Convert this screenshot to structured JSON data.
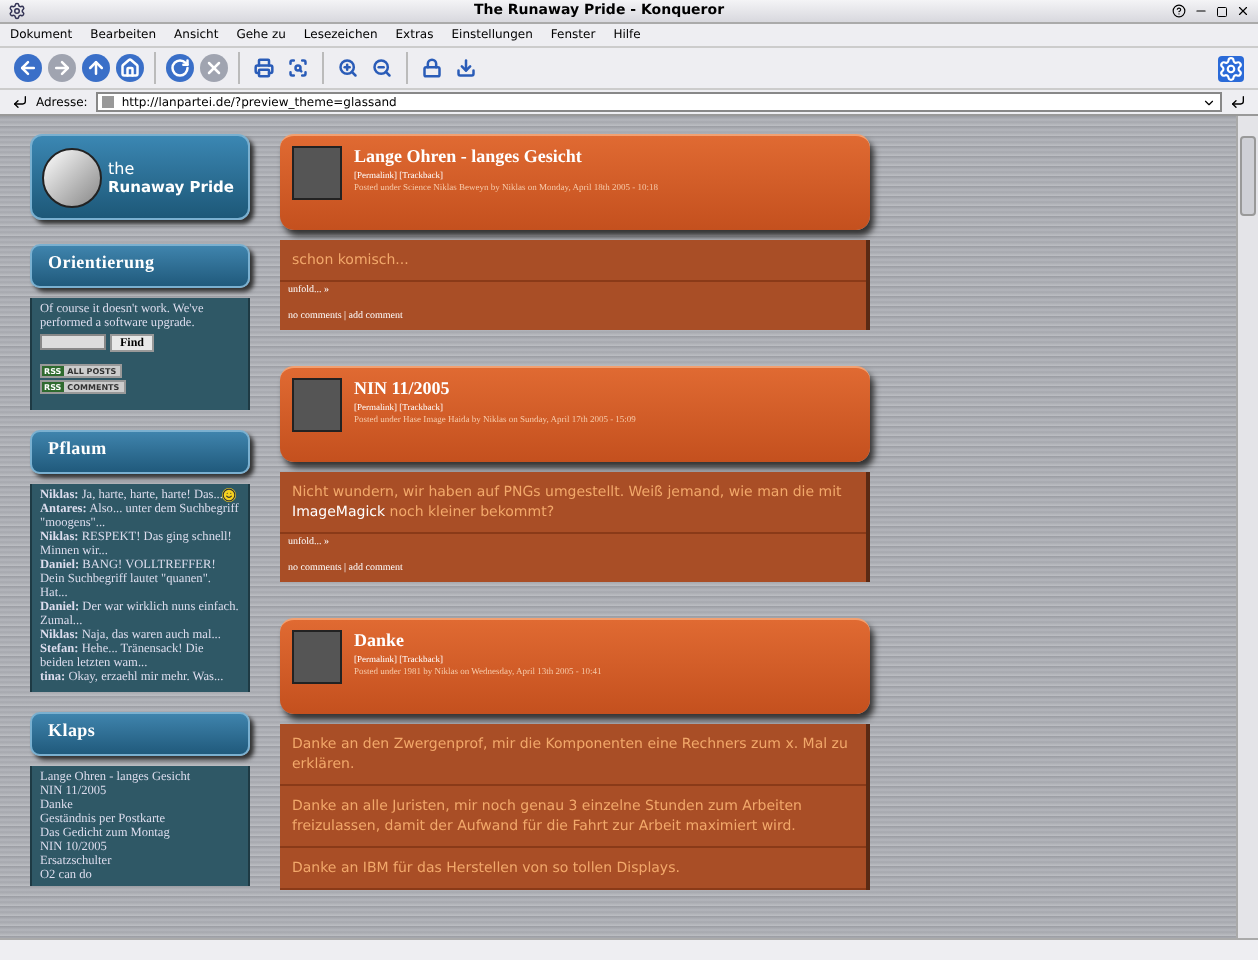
{
  "window": {
    "title": "The Runaway Pride - Konqueror"
  },
  "menu": [
    "Dokument",
    "Bearbeiten",
    "Ansicht",
    "Gehe zu",
    "Lesezeichen",
    "Extras",
    "Einstellungen",
    "Fenster",
    "Hilfe"
  ],
  "address": {
    "label": "Adresse:",
    "value": "http://lanpartei.de/?preview_theme=glassand"
  },
  "logo": {
    "line1": "the",
    "line2": "Runaway Pride"
  },
  "sidebar": [
    {
      "kind": "search",
      "title": "Orientierung",
      "text": "Of course it doesn't work. We've performed a software upgrade.",
      "button": "Find",
      "badges": [
        {
          "tag": "RSS",
          "label": "ALL POSTS"
        },
        {
          "tag": "RSS",
          "label": "COMMENTS"
        }
      ]
    },
    {
      "kind": "comments",
      "title": "Pflaum",
      "comments": [
        {
          "author": "Niklas:",
          "text": "Ja, harte, harte, harte! Das...",
          "emoticon": true
        },
        {
          "author": "Antares:",
          "text": "Also... unter dem Suchbegriff \"moogens\"...",
          "emoticon": false
        },
        {
          "author": "Niklas:",
          "text": "RESPEKT! Das ging schnell! Minnen wir...",
          "emoticon": false
        },
        {
          "author": "Daniel:",
          "text": "BANG! VOLLTREFFER! Dein Suchbegriff lautet \"quanen\". Hat...",
          "emoticon": false
        },
        {
          "author": "Daniel:",
          "text": "Der war wirklich nuns einfach. Zumal...",
          "emoticon": false
        },
        {
          "author": "Niklas:",
          "text": "Naja, das waren auch mal...",
          "emoticon": false
        },
        {
          "author": "Stefan:",
          "text": "Hehe... Tränensack! Die beiden letzten wam...",
          "emoticon": false
        },
        {
          "author": "tina:",
          "text": "Okay, erzaehl mir mehr. Was...",
          "emoticon": false
        }
      ]
    },
    {
      "kind": "links",
      "title": "Klaps",
      "links": [
        "Lange Ohren - langes Gesicht",
        "NIN 11/2005",
        "Danke",
        "Geständnis per Postkarte",
        "Das Gedicht zum Montag",
        "NIN 10/2005",
        "Ersatzschulter",
        "O2 can do"
      ]
    }
  ],
  "posts": [
    {
      "title": "Lange Ohren - langes Gesicht",
      "links": "[Permalink] [Trackback]",
      "meta": "Posted under Science Niklas Beweyn by Niklas on Monday, April 18th 2005 - 10:18",
      "paragraphs": [
        "schon komisch..."
      ],
      "unfold": "unfold... »",
      "footer": "no comments | add comment"
    },
    {
      "title": "NIN 11/2005",
      "links": "[Permalink] [Trackback]",
      "meta": "Posted under Hase Image Haida by Niklas on Sunday, April 17th 2005 - 15:09",
      "paragraphs": [
        "Nicht wundern, wir haben auf PNGs umgestellt. Weiß jemand, wie man die mit **ImageMagick** noch kleiner bekommt?"
      ],
      "unfold": "unfold... »",
      "footer": "no comments | add comment"
    },
    {
      "title": "Danke",
      "links": "[Permalink] [Trackback]",
      "meta": "Posted under 1981 by Niklas on Wednesday, April 13th 2005 - 10:41",
      "paragraphs": [
        "Danke an den Zwergenprof, mir die Komponenten eine Rechners zum x. Mal zu erklären.",
        "Danke an alle Juristen, mir noch genau 3 einzelne Stunden zum Arbeiten freizulassen, damit der Aufwand für die Fahrt zur Arbeit maximiert wird.",
        "Danke an IBM für das Herstellen von so tollen Displays."
      ]
    }
  ]
}
